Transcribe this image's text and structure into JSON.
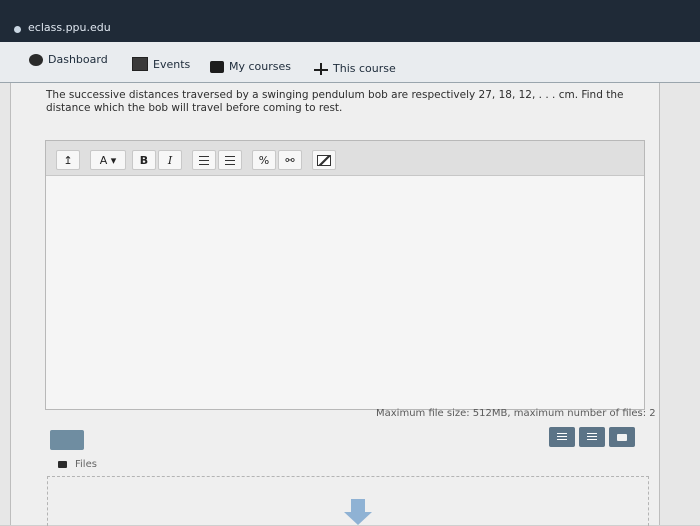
{
  "browser": {
    "url": "eclass.ppu.edu"
  },
  "nav": {
    "items": [
      {
        "label": "Dashboard",
        "icon": "tachometer-icon"
      },
      {
        "label": "Events",
        "icon": "calendar-icon"
      },
      {
        "label": "My courses",
        "icon": "briefcase-icon"
      },
      {
        "label": "This course",
        "icon": "sitemap-icon"
      }
    ]
  },
  "question": {
    "text": "The successive distances traversed by a swinging pendulum bob are respectively 27, 18, 12, . . . cm. Find the distance which the bob will travel before coming to rest."
  },
  "editor": {
    "toolbar": {
      "collapse": "↥",
      "font": "A ▾",
      "bold": "B",
      "italic": "I",
      "link": "%",
      "unlink": "⚯"
    }
  },
  "attachments": {
    "max_file_text": "Maximum file size: 512MB, maximum number of files: 2",
    "files_label": "Files"
  }
}
